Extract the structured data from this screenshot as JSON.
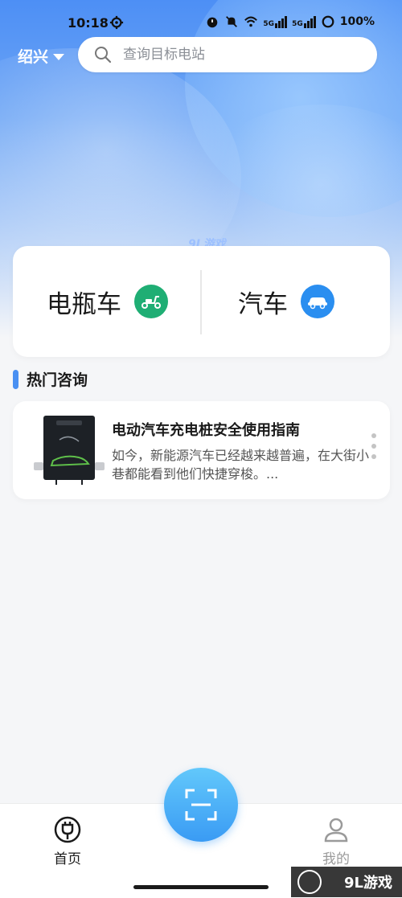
{
  "status_bar": {
    "time": "10:18",
    "battery": "100%",
    "network_1": "5G",
    "network_2": "5G"
  },
  "header": {
    "city": "绍兴",
    "search_placeholder": "查询目标电站"
  },
  "watermark_top": "9L游戏",
  "categories": [
    {
      "label": "电瓶车",
      "icon": "scooter-icon",
      "color": "#1fae74"
    },
    {
      "label": "汽车",
      "icon": "car-icon",
      "color": "#2a8ef0"
    }
  ],
  "section": {
    "title": "热门咨询",
    "accent": "#4a90f2"
  },
  "news": [
    {
      "title": "电动汽车充电桩安全使用指南",
      "desc": "如今，新能源汽车已经越来越普遍，在大街小巷都能看到他们快捷穿梭。..."
    }
  ],
  "tabbar": {
    "home_label": "首页",
    "mine_label": "我的",
    "scan_icon": "scan-icon"
  },
  "watermark_bottom": "9L游戏"
}
